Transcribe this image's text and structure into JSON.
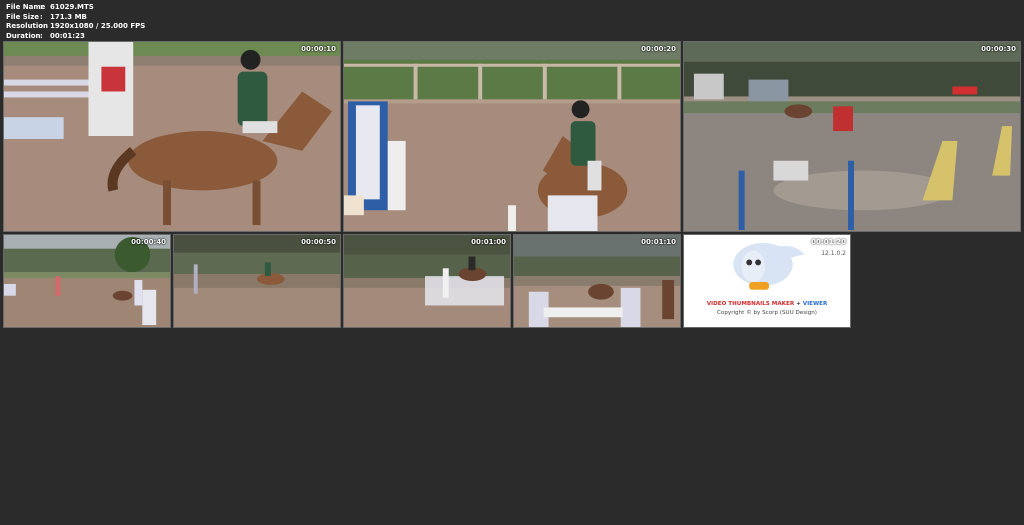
{
  "info": {
    "file_name_label": "File Name",
    "file_name": "61029.MTS",
    "file_size_label": "File Size",
    "file_size": "171.3 MB",
    "resolution_label": "Resolution",
    "resolution": "1920x1080 / 25.000 FPS",
    "duration_label": "Duration",
    "duration": "00:01:23",
    "separator": ":"
  },
  "thumbnails": [
    {
      "timestamp": "00:00:10"
    },
    {
      "timestamp": "00:00:20"
    },
    {
      "timestamp": "00:00:30"
    },
    {
      "timestamp": "00:00:40"
    },
    {
      "timestamp": "00:00:50"
    },
    {
      "timestamp": "00:01:00"
    },
    {
      "timestamp": "00:01:10"
    }
  ],
  "logo_tile": {
    "timestamp": "00:01:20",
    "version": "12.1.0.2",
    "brand_part1": "VIDEO THUMBNAILS MAKER",
    "brand_plus": " + ",
    "brand_part2": "VIEWER",
    "copyright": "Copyright © by Scorp (SUU Design)"
  },
  "colors": {
    "background": "#2b2b2b",
    "sand": "#a08474",
    "grass": "#5c7a45"
  }
}
